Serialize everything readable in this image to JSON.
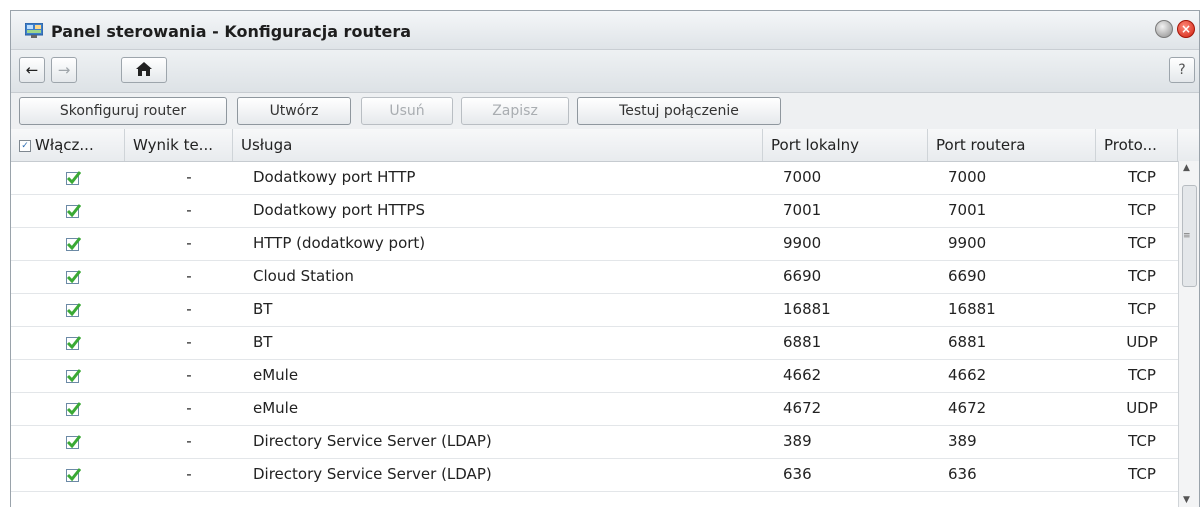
{
  "window": {
    "title": "Panel sterowania - Konfiguracja routera"
  },
  "nav": {
    "back_icon": "←",
    "forward_icon": "→",
    "home_icon": "⌂",
    "help_label": "?"
  },
  "toolbar": {
    "configure_label": "Skonfiguruj router",
    "create_label": "Utwórz",
    "delete_label": "Usuń",
    "save_label": "Zapisz",
    "test_label": "Testuj połączenie"
  },
  "table": {
    "columns": {
      "enabled": "Włącz...",
      "result": "Wynik te...",
      "service": "Usługa",
      "local_port": "Port lokalny",
      "router_port": "Port routera",
      "protocol": "Proto..."
    },
    "rows": [
      {
        "enabled": true,
        "result": "-",
        "service": "Dodatkowy port HTTP",
        "local_port": "7000",
        "router_port": "7000",
        "protocol": "TCP"
      },
      {
        "enabled": true,
        "result": "-",
        "service": "Dodatkowy port HTTPS",
        "local_port": "7001",
        "router_port": "7001",
        "protocol": "TCP"
      },
      {
        "enabled": true,
        "result": "-",
        "service": "HTTP (dodatkowy port)",
        "local_port": "9900",
        "router_port": "9900",
        "protocol": "TCP"
      },
      {
        "enabled": true,
        "result": "-",
        "service": "Cloud Station",
        "local_port": "6690",
        "router_port": "6690",
        "protocol": "TCP"
      },
      {
        "enabled": true,
        "result": "-",
        "service": "BT",
        "local_port": "16881",
        "router_port": "16881",
        "protocol": "TCP"
      },
      {
        "enabled": true,
        "result": "-",
        "service": "BT",
        "local_port": "6881",
        "router_port": "6881",
        "protocol": "UDP"
      },
      {
        "enabled": true,
        "result": "-",
        "service": "eMule",
        "local_port": "4662",
        "router_port": "4662",
        "protocol": "TCP"
      },
      {
        "enabled": true,
        "result": "-",
        "service": "eMule",
        "local_port": "4672",
        "router_port": "4672",
        "protocol": "UDP"
      },
      {
        "enabled": true,
        "result": "-",
        "service": "Directory Service Server (LDAP)",
        "local_port": "389",
        "router_port": "389",
        "protocol": "TCP"
      },
      {
        "enabled": true,
        "result": "-",
        "service": "Directory Service Server (LDAP)",
        "local_port": "636",
        "router_port": "636",
        "protocol": "TCP"
      }
    ]
  },
  "colors": {
    "check_green": "#3aa935",
    "close_red": "#d01f0f"
  }
}
